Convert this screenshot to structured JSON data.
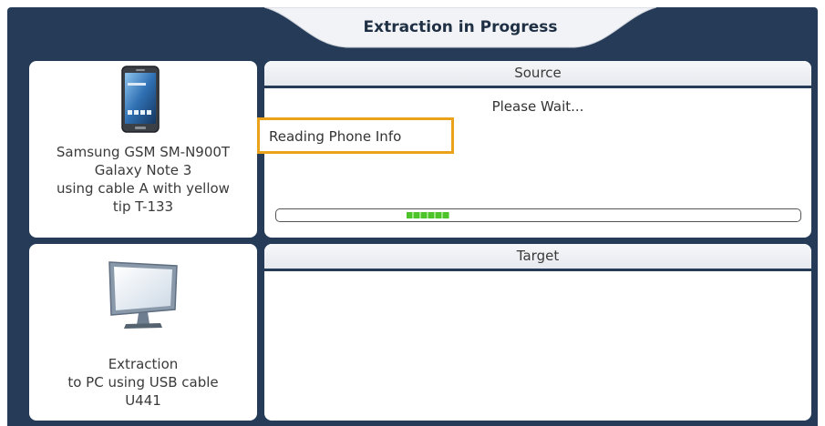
{
  "header": {
    "title": "Extraction in Progress"
  },
  "device": {
    "icon": "phone-icon",
    "caption_lines": [
      "Samsung GSM SM-N900T",
      "Galaxy Note 3",
      "using cable A with yellow",
      "tip T-133"
    ]
  },
  "destination": {
    "icon": "monitor-icon",
    "caption_lines": [
      "Extraction",
      "to PC using USB cable",
      "U441"
    ]
  },
  "source": {
    "header": "Source",
    "status": "Please Wait...",
    "info": "Reading Phone Info",
    "progress": 0.09
  },
  "target": {
    "header": "Target"
  },
  "colors": {
    "background": "#253b57",
    "highlight": "#e9a21a",
    "progress": "#4cc329"
  }
}
